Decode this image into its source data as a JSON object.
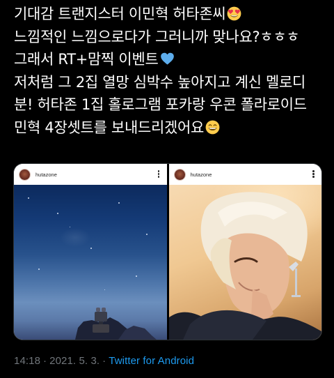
{
  "tweet": {
    "lines": [
      "기대감 트랜지스터 이민혁 허타존씨",
      "느낌적인 느낌으로다가 그러니까 맞나요?ㅎㅎㅎ",
      "그래서 RT+맘찍 이벤트",
      "저처럼 그 2집 열망 심박수 높아지고 계신 멜로디",
      "분! 허타존 1집 홀로그램 포카랑 우콘 폴라로이드",
      "민혁 4장셋트를 보내드리겠어요"
    ],
    "emojis": [
      "heart-eyes-emoji",
      "blue-heart-emoji",
      "grinning-smile-emoji"
    ]
  },
  "media": [
    {
      "username": "hutazone",
      "photo": "night-sky-robot-photo"
    },
    {
      "username": "hutazone",
      "photo": "blonde-person-portrait-photo"
    }
  ],
  "meta": {
    "time": "14:18",
    "date": "2021. 5. 3.",
    "separator": "·",
    "source": "Twitter for Android"
  },
  "colors": {
    "background": "#000000",
    "text": "#ffffff",
    "meta_text": "#71767b",
    "link": "#1d9bf0",
    "emoji_face": "#ffcc4d",
    "emoji_heart_red": "#e8344a",
    "emoji_blue_heart": "#5dadec"
  }
}
